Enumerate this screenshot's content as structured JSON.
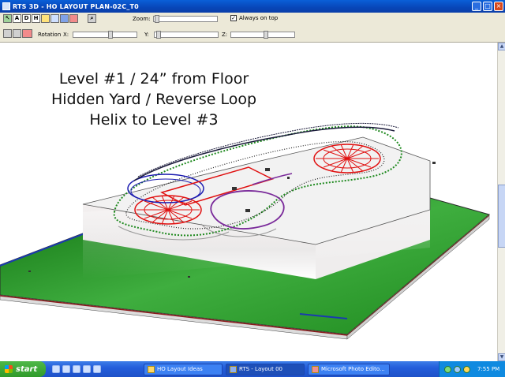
{
  "window": {
    "title": "RTS 3D - HO LAYOUT PLAN-02C_T0",
    "minimize": "_",
    "maximize": "□",
    "close": "×"
  },
  "toolbar": {
    "row1_buttons": [
      "A",
      "D",
      "H"
    ],
    "zoom_label": "Zoom:",
    "zoom_value": 0.02,
    "always_on_top_label": "Always on top",
    "always_on_top_checked": "✓",
    "rotation_label": "Rotation",
    "x_label": "X:",
    "x_value": 0.6,
    "y_label": "Y:",
    "y_value": 0.03,
    "z_label": "Z:",
    "z_value": 0.55
  },
  "overlay": {
    "line1": "Level #1 / 24” from Floor",
    "line2": "Hidden Yard / Reverse Loop",
    "line3": "Helix to Level #3"
  },
  "taskbar": {
    "start_label": "start",
    "tasks": [
      "HO Layout Ideas",
      "RTS - Layout 00",
      "Microsoft Photo Edito..."
    ],
    "clock": "7:55 PM"
  },
  "colors": {
    "track_dark": "#1a1a3a",
    "table_green": "#1f8a1f",
    "helix_red": "#e01010",
    "loop_blue": "#1a1ab0",
    "loop_purple": "#7a2a9a"
  }
}
